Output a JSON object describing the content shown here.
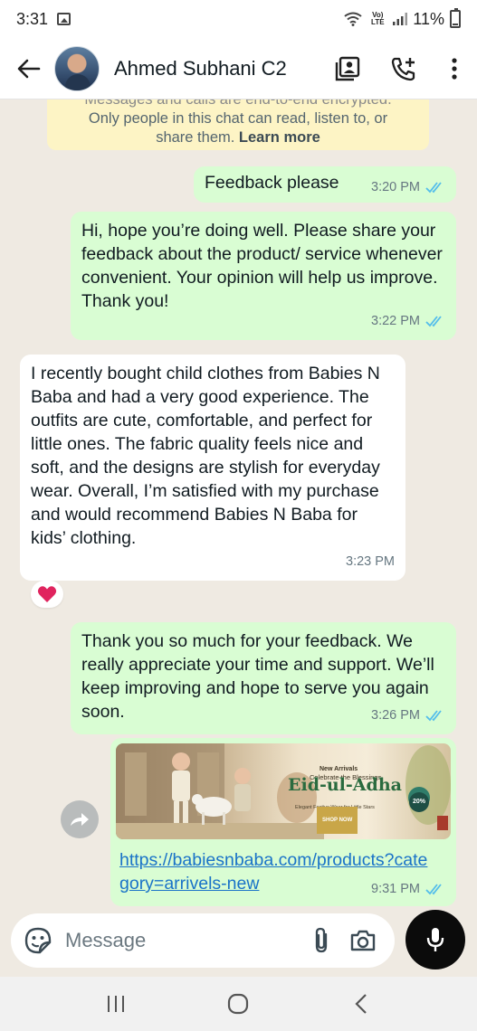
{
  "status_bar": {
    "time": "3:31",
    "network": "Vo) LTE",
    "battery": "11%"
  },
  "header": {
    "contact_name": "Ahmed Subhani C2"
  },
  "encryption_notice": {
    "line1": "Messages and calls are end-to-end encrypted.",
    "line2": "Only people in this chat can read, listen to, or",
    "line3": "share them.",
    "link": "Learn more"
  },
  "messages": [
    {
      "direction": "out",
      "text": "Feedback please",
      "time": "3:20 PM",
      "status": "read"
    },
    {
      "direction": "out",
      "text": "Hi, hope you’re doing well. Please share your feedback about the product/ service whenever convenient. Your opinion will help us improve. Thank you!",
      "time": "3:22 PM",
      "status": "read"
    },
    {
      "direction": "in",
      "text": "I recently bought child clothes from Babies N Baba and had a very good experience. The outfits are cute, comfortable, and perfect for little ones. The fabric quality feels nice and soft, and the designs are stylish for everyday wear. Overall, I’m satisfied with my purchase and would recommend Babies N Baba for kids’ clothing.",
      "time": "3:23 PM",
      "reaction": "❤️"
    },
    {
      "direction": "out",
      "text": "Thank you so much for your feedback. We really appreciate your time and support. We’ll keep improving and hope to serve you again soon.",
      "time": "3:26 PM",
      "status": "read"
    },
    {
      "direction": "out",
      "link_preview": {
        "kicker": "New Arrivals",
        "subtitle": "Celebrate the Blessings",
        "title": "Eid-ul-Adha",
        "tagline": "Elegant Festive Wear for Little Stars",
        "cta": "SHOP NOW",
        "badge": "20%"
      },
      "link": "https://babiesnbaba.com/products?category=arrivels-new",
      "time": "9:31 PM",
      "status": "read"
    }
  ],
  "composer": {
    "placeholder": "Message"
  },
  "colors": {
    "outgoing_bubble": "#d9fdd3",
    "incoming_bubble": "#ffffff",
    "read_ticks": "#53bdeb",
    "chat_bg": "#efeae2",
    "link": "#1a73c8"
  }
}
